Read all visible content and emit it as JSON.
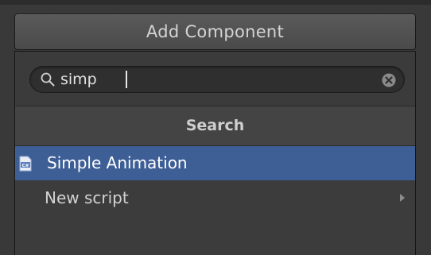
{
  "add_component_button": {
    "label": "Add Component"
  },
  "search": {
    "value": "simp",
    "placeholder": "",
    "icon": "search-icon",
    "clear_icon": "clear-icon"
  },
  "results_header": {
    "label": "Search"
  },
  "results": [
    {
      "label": "Simple Animation",
      "icon": "csharp-script-icon",
      "selected": true
    }
  ],
  "new_script": {
    "label": "New script",
    "icon": "chevron-right-icon"
  },
  "colors": {
    "selection": "#3e5f96",
    "background": "#393939",
    "panel": "#3c3c3c"
  }
}
